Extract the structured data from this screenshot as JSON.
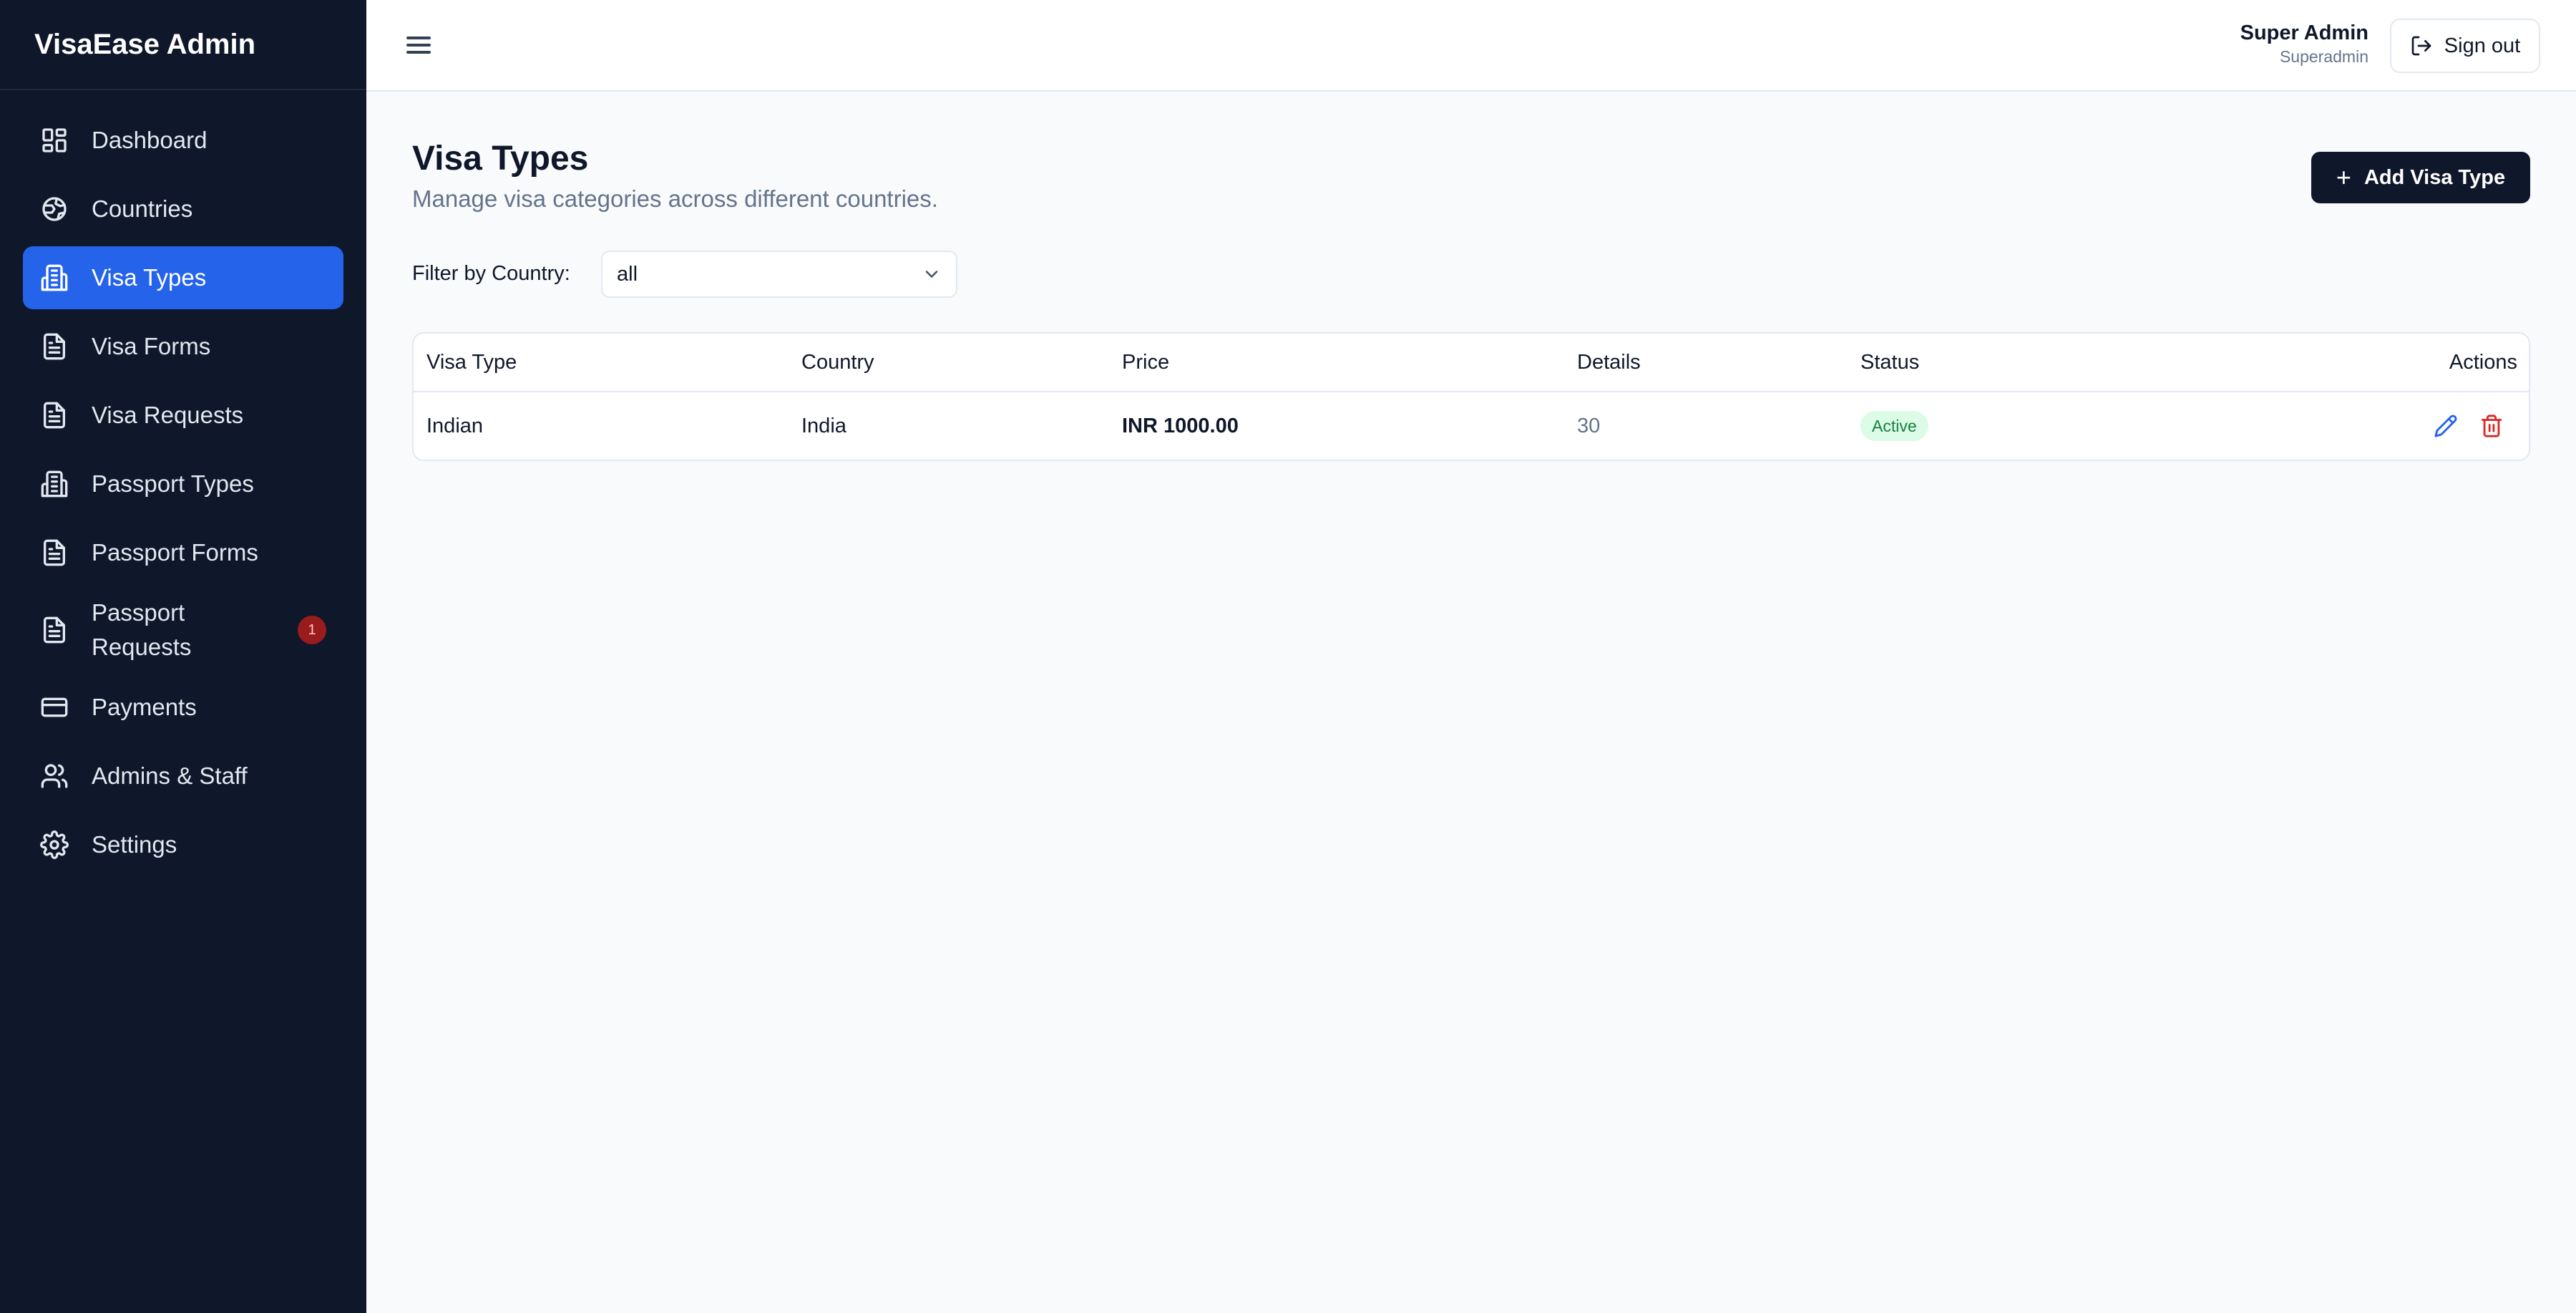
{
  "app": {
    "title": "VisaEase Admin"
  },
  "sidebar": {
    "items": [
      {
        "label": "Dashboard",
        "icon": "dashboard-icon",
        "active": false
      },
      {
        "label": "Countries",
        "icon": "globe-icon",
        "active": false
      },
      {
        "label": "Visa Types",
        "icon": "building-icon",
        "active": true
      },
      {
        "label": "Visa Forms",
        "icon": "document-icon",
        "active": false
      },
      {
        "label": "Visa Requests",
        "icon": "document-icon",
        "active": false
      },
      {
        "label": "Passport Types",
        "icon": "building-icon",
        "active": false
      },
      {
        "label": "Passport Forms",
        "icon": "document-icon",
        "active": false
      },
      {
        "label": "Passport Requests",
        "icon": "document-icon",
        "active": false,
        "badge": "1"
      },
      {
        "label": "Payments",
        "icon": "credit-card-icon",
        "active": false
      },
      {
        "label": "Admins & Staff",
        "icon": "users-icon",
        "active": false
      },
      {
        "label": "Settings",
        "icon": "gear-icon",
        "active": false
      }
    ]
  },
  "header": {
    "user_name": "Super Admin",
    "user_role": "Superadmin",
    "signout_label": "Sign out"
  },
  "main": {
    "title": "Visa Types",
    "subtitle": "Manage visa categories across different countries.",
    "add_button_label": "Add Visa Type",
    "filter": {
      "label": "Filter by Country:",
      "value": "all"
    },
    "table": {
      "columns": [
        "Visa Type",
        "Country",
        "Price",
        "Details",
        "Status",
        "Actions"
      ],
      "rows": [
        {
          "visa_type": "Indian",
          "country": "India",
          "price": "INR 1000.00",
          "details": "30",
          "status": "Active"
        }
      ]
    }
  },
  "colors": {
    "sidebar_bg": "#0f172a",
    "active_item": "#2563eb",
    "badge": "#991b1b",
    "status_active_bg": "#dcfce7",
    "status_active_text": "#15803d",
    "edit_icon": "#2563eb",
    "delete_icon": "#dc2626"
  }
}
